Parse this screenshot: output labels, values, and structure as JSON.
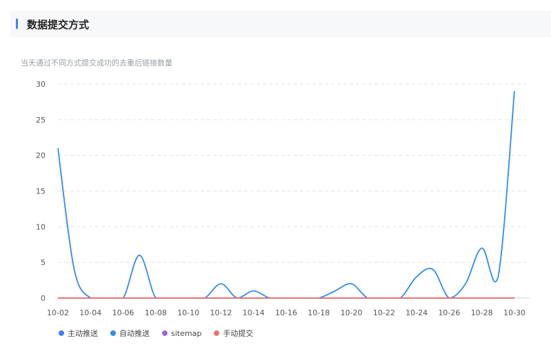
{
  "header": {
    "title": "数据提交方式"
  },
  "subtitle": "当天通过不同方式提交成功的去重后链接数量",
  "chart_data": {
    "type": "line",
    "x": [
      "10-02",
      "10-03",
      "10-04",
      "10-05",
      "10-06",
      "10-07",
      "10-08",
      "10-09",
      "10-10",
      "10-11",
      "10-12",
      "10-13",
      "10-14",
      "10-15",
      "10-16",
      "10-17",
      "10-18",
      "10-19",
      "10-20",
      "10-21",
      "10-22",
      "10-23",
      "10-24",
      "10-25",
      "10-26",
      "10-27",
      "10-28",
      "10-29",
      "10-30"
    ],
    "xticks": [
      "10-02",
      "10-04",
      "10-06",
      "10-08",
      "10-10",
      "10-12",
      "10-14",
      "10-16",
      "10-18",
      "10-20",
      "10-22",
      "10-24",
      "10-26",
      "10-28",
      "10-30"
    ],
    "ylim": [
      0,
      30
    ],
    "yticks": [
      0,
      5,
      10,
      15,
      20,
      25,
      30
    ],
    "grid": true,
    "legend_position": "bottom-left",
    "series": [
      {
        "name": "主动推送",
        "color": "#3b82f6",
        "values": [
          0,
          0,
          0,
          0,
          0,
          0,
          0,
          0,
          0,
          0,
          0,
          0,
          0,
          0,
          0,
          0,
          0,
          0,
          0,
          0,
          0,
          0,
          0,
          0,
          0,
          0,
          0,
          0,
          0
        ]
      },
      {
        "name": "自动推送",
        "color": "#2b8cea",
        "values": [
          21,
          4,
          0,
          0,
          0,
          6,
          0,
          0,
          0,
          0,
          2,
          0,
          1,
          0,
          0,
          0,
          0,
          1,
          2,
          0,
          0,
          0,
          3,
          4,
          0,
          2,
          7,
          3,
          29
        ]
      },
      {
        "name": "sitemap",
        "color": "#9b6bd8",
        "values": [
          0,
          0,
          0,
          0,
          0,
          0,
          0,
          0,
          0,
          0,
          0,
          0,
          0,
          0,
          0,
          0,
          0,
          0,
          0,
          0,
          0,
          0,
          0,
          0,
          0,
          0,
          0,
          0,
          0
        ]
      },
      {
        "name": "手动提交",
        "color": "#f0706a",
        "values": [
          0,
          0,
          0,
          0,
          0,
          0,
          0,
          0,
          0,
          0,
          0,
          0,
          0,
          0,
          0,
          0,
          0,
          0,
          0,
          0,
          0,
          0,
          0,
          0,
          0,
          0,
          0,
          0,
          0
        ]
      }
    ]
  }
}
